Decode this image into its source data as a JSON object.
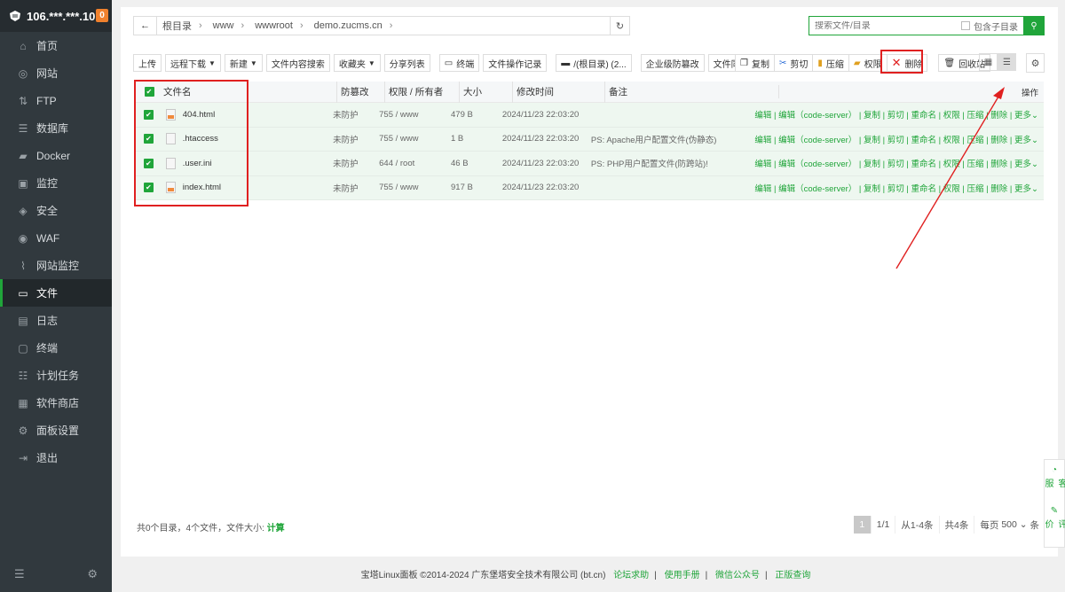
{
  "sidebar": {
    "host": "106.***.***.10",
    "badge": "0",
    "items": [
      {
        "label": "首页",
        "icon": "home-icon"
      },
      {
        "label": "网站",
        "icon": "globe-icon"
      },
      {
        "label": "FTP",
        "icon": "ftp-icon"
      },
      {
        "label": "数据库",
        "icon": "database-icon"
      },
      {
        "label": "Docker",
        "icon": "docker-icon"
      },
      {
        "label": "监控",
        "icon": "monitor-icon"
      },
      {
        "label": "安全",
        "icon": "shield-icon"
      },
      {
        "label": "WAF",
        "icon": "waf-icon"
      },
      {
        "label": "网站监控",
        "icon": "chart-icon"
      },
      {
        "label": "文件",
        "icon": "folder-icon",
        "active": true
      },
      {
        "label": "日志",
        "icon": "log-icon"
      },
      {
        "label": "终端",
        "icon": "terminal-icon"
      },
      {
        "label": "计划任务",
        "icon": "task-icon"
      },
      {
        "label": "软件商店",
        "icon": "store-icon"
      },
      {
        "label": "面板设置",
        "icon": "settings-icon"
      },
      {
        "label": "退出",
        "icon": "logout-icon"
      }
    ]
  },
  "path": {
    "crumbs": [
      "根目录",
      "www",
      "wwwroot",
      "demo.zucms.cn"
    ]
  },
  "search": {
    "placeholder": "搜索文件/目录",
    "include_sub": "包含子目录"
  },
  "toolbar": {
    "upload": "上传",
    "remote_download": "远程下载",
    "new": "新建",
    "content_search": "文件内容搜索",
    "favorites": "收藏夹",
    "share_list": "分享列表",
    "terminal": "终端",
    "op_log": "文件操作记录",
    "root_dir": "/(根目录) (2...",
    "tamper": "企业级防篡改",
    "sync": "文件同步",
    "copy": "复制",
    "cut": "剪切",
    "compress": "压缩",
    "perm": "权限",
    "delete": "删除",
    "recycle": "回收站"
  },
  "table": {
    "headers": {
      "name": "文件名",
      "protect": "防篡改",
      "perm": "权限 / 所有者",
      "size": "大小",
      "mtime": "修改时间",
      "note": "备注",
      "ops": "操作"
    },
    "rows": [
      {
        "name": "404.html",
        "protect": "未防护",
        "perm": "755 / www",
        "size": "479 B",
        "mtime": "2024/11/23 22:03:20",
        "note": "",
        "type": "html"
      },
      {
        "name": ".htaccess",
        "protect": "未防护",
        "perm": "755 / www",
        "size": "1 B",
        "mtime": "2024/11/23 22:03:20",
        "note": "PS: Apache用户配置文件(伪静态)",
        "type": "file"
      },
      {
        "name": ".user.ini",
        "protect": "未防护",
        "perm": "644 / root",
        "size": "46 B",
        "mtime": "2024/11/23 22:03:20",
        "note": "PS: PHP用户配置文件(防跨站)!",
        "type": "file"
      },
      {
        "name": "index.html",
        "protect": "未防护",
        "perm": "755 / www",
        "size": "917 B",
        "mtime": "2024/11/23 22:03:20",
        "note": "",
        "type": "html"
      }
    ],
    "ops": "编辑 | 编辑（code-server） | 复制 | 剪切 | 重命名 | 权限 | 压缩 | 删除 | 更多"
  },
  "summary": {
    "text": "共0个目录，4个文件，文件大小:",
    "calc": "计算"
  },
  "pager": {
    "current": "1",
    "pages": "1/1",
    "range": "从1-4条",
    "total": "共4条",
    "per_page_label": "每页",
    "per_page": "500",
    "unit": "条"
  },
  "copyright": {
    "text": "宝塔Linux面板 ©2014-2024 广东堡塔安全技术有限公司 (bt.cn)",
    "links": [
      "论坛求助",
      "使用手册",
      "微信公众号",
      "正版查询"
    ]
  },
  "cs": {
    "service": "客服",
    "rate": "评价"
  },
  "colors": {
    "accent": "#20a53a",
    "highlight": "#e02020",
    "sidebar": "#31393e"
  }
}
